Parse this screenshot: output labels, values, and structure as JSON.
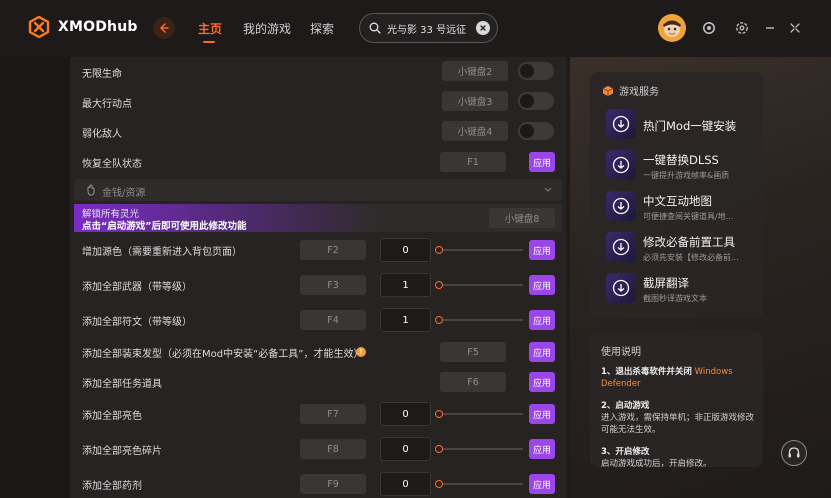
{
  "header": {
    "logo_text": "XMODhub",
    "nav": [
      {
        "label": "主页",
        "active": true
      },
      {
        "label": "我的游戏",
        "active": false
      },
      {
        "label": "探索",
        "active": false
      }
    ],
    "search_value": "光与影 33 号远征"
  },
  "main": {
    "rows_top": [
      {
        "label": "无限生命",
        "key": "小键盘2",
        "control": "toggle"
      },
      {
        "label": "最大行动点",
        "key": "小键盘3",
        "control": "toggle"
      },
      {
        "label": "弱化敌人",
        "key": "小键盘4",
        "control": "toggle"
      },
      {
        "label": "恢复全队状态",
        "key": "F1",
        "control": "apply"
      }
    ],
    "section_label": "金钱/资源",
    "banner": {
      "line1": "解锁所有灵光",
      "line2": "点击“启动游戏”后即可使用此修改功能",
      "key": "小键盘8"
    },
    "rows": [
      {
        "label": "增加源色（需要重新进入背包页面）",
        "key": "F2",
        "value": "0",
        "slider": true
      },
      {
        "label": "添加全部武器（带等级）",
        "key": "F3",
        "value": "1",
        "slider": true
      },
      {
        "label": "添加全部符文（带等级）",
        "key": "F4",
        "value": "1",
        "slider": true
      },
      {
        "label": "添加全部装束发型（必须在Mod中安装“必备工具”，才能生效）",
        "key": "F5",
        "warn": true
      },
      {
        "label": "添加全部任务道具",
        "key": "F6"
      },
      {
        "label": "添加全部亮色",
        "key": "F7",
        "value": "0",
        "slider": true
      },
      {
        "label": "添加全部亮色碎片",
        "key": "F8",
        "value": "0",
        "slider": true
      },
      {
        "label": "添加全部药剂",
        "key": "F9",
        "value": "0",
        "slider": true
      }
    ],
    "apply_label": "应用"
  },
  "services": {
    "title": "游戏服务",
    "items": [
      {
        "name": "热门Mod一键安装",
        "desc": ""
      },
      {
        "name": "一键替换DLSS",
        "desc": "一键提升游戏帧率&画质"
      },
      {
        "name": "中文互动地图",
        "desc": "可便捷查阅关键道具/地..."
      },
      {
        "name": "修改必备前置工具",
        "desc": "必须先安装【修改必备前..."
      },
      {
        "name": "截屏翻译",
        "desc": "截图秒译游戏文本"
      }
    ]
  },
  "help": {
    "title": "使用说明",
    "steps": [
      {
        "head": "1、退出杀毒软件并关闭",
        "highlight": "Windows Defender",
        "body": ""
      },
      {
        "head": "2、启动游戏",
        "highlight": "",
        "body": "进入游戏，需保持单机；非正版游戏修改可能无法生效。"
      },
      {
        "head": "3、开启修改",
        "highlight": "",
        "body": "启动游戏成功后，开启修改。"
      }
    ]
  },
  "colors": {
    "accent": "#ff6a2a",
    "purple": "#9a46e8"
  }
}
